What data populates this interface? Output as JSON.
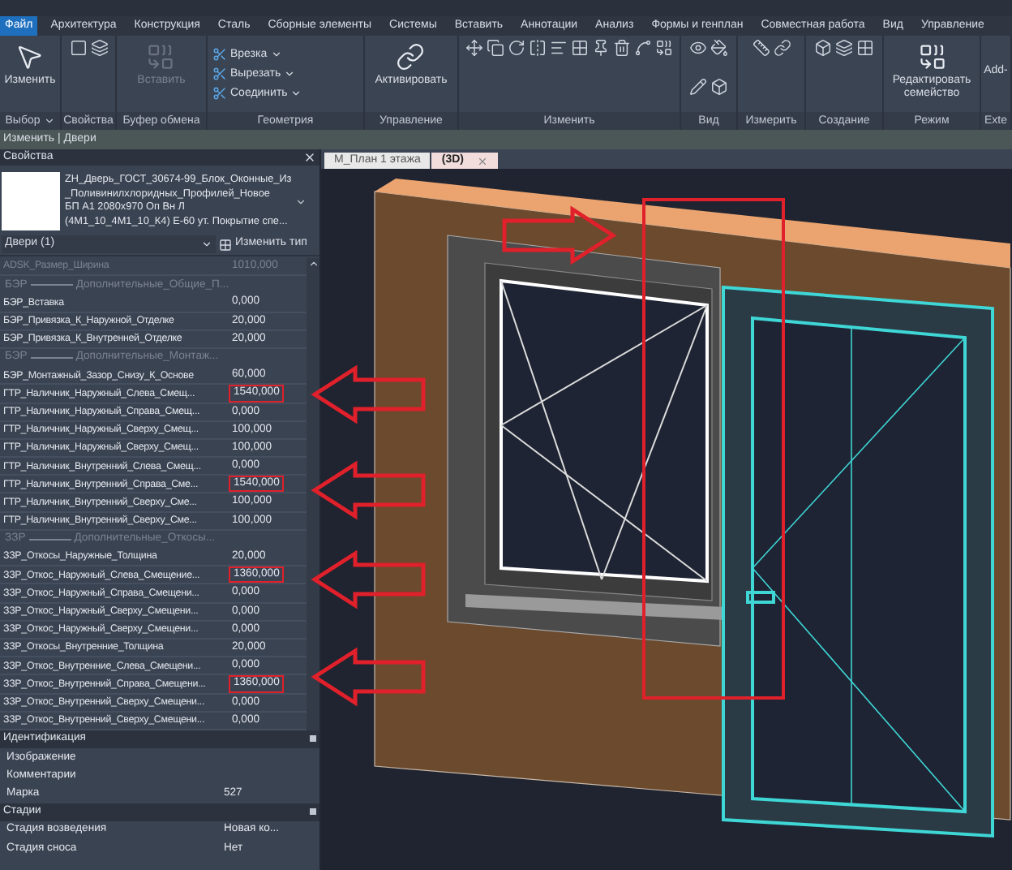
{
  "menu": [
    {
      "label": "Файл",
      "selected": true
    },
    {
      "label": "Архитектура",
      "selected": false
    },
    {
      "label": "Конструкция",
      "selected": false
    },
    {
      "label": "Сталь",
      "selected": false
    },
    {
      "label": "Сборные элементы",
      "selected": false
    },
    {
      "label": "Системы",
      "selected": false
    },
    {
      "label": "Вставить",
      "selected": false
    },
    {
      "label": "Аннотации",
      "selected": false
    },
    {
      "label": "Анализ",
      "selected": false
    },
    {
      "label": "Формы и генплан",
      "selected": false
    },
    {
      "label": "Совместная работа",
      "selected": false
    },
    {
      "label": "Вид",
      "selected": false
    },
    {
      "label": "Управление",
      "selected": false
    }
  ],
  "ribbon": [
    {
      "label": "Выбор",
      "dropdown": true,
      "tools": [
        {
          "kind": "large",
          "label": "Изменить",
          "disabled": false
        }
      ]
    },
    {
      "label": "Свойства"
    },
    {
      "label": "Буфер обмена",
      "tools": [
        {
          "kind": "large",
          "label": "Вставить",
          "disabled": true
        }
      ]
    },
    {
      "label": "Геометрия",
      "tools": [
        {
          "kind": "stack",
          "label": "Врезка",
          "disabled": false
        },
        {
          "kind": "stack",
          "label": "Вырезать",
          "disabled": false
        },
        {
          "kind": "stack",
          "label": "Соединить",
          "disabled": false
        }
      ]
    },
    {
      "label": "Управление",
      "tools": [
        {
          "kind": "large",
          "label": "Активировать",
          "disabled": false
        }
      ]
    },
    {
      "label": "Изменить"
    },
    {
      "label": "Вид"
    },
    {
      "label": "Измерить"
    },
    {
      "label": "Создание"
    },
    {
      "label": "Режим",
      "tools": [
        {
          "kind": "large",
          "label": "Редактировать семейство",
          "disabled": false
        }
      ]
    },
    {
      "label": "Exte",
      "tools": [
        {
          "kind": "text",
          "label": "Add-",
          "disabled": false
        }
      ]
    }
  ],
  "context_bar": "Изменить | Двери",
  "properties": {
    "title": "Свойства",
    "type_name": [
      "ZH_Дверь_ГОСТ_30674-99_Блок_Оконные_Из",
      "_Поливинилхлоридных_Профилей_Новое",
      "БП А1 2080х970 Оп Вн Л",
      "(4М1_10_4М1_10_К4) Е-60 ут.  Покрытие спе..."
    ],
    "selector": "Двери (1)",
    "edit_type": "Изменить тип",
    "rows": [
      {
        "kind": "param",
        "name": "ADSK_Размер_Ширина",
        "value": "1010,000",
        "disabled": true,
        "highlighted": false
      },
      {
        "kind": "separator",
        "prefix": "БЭР",
        "name": "Дополнительные_Общие_П..."
      },
      {
        "kind": "param",
        "name": "БЭР_Вставка",
        "value": "0,000",
        "disabled": false,
        "highlighted": false
      },
      {
        "kind": "param",
        "name": "БЭР_Привязка_К_Наружной_Отделке",
        "value": "20,000",
        "disabled": false,
        "highlighted": false
      },
      {
        "kind": "param",
        "name": "БЭР_Привязка_К_Внутренней_Отделке",
        "value": "20,000",
        "disabled": false,
        "highlighted": false
      },
      {
        "kind": "separator",
        "prefix": "БЭР",
        "name": "Дополнительные_Монтаж..."
      },
      {
        "kind": "param",
        "name": "БЭР_Монтажный_Зазор_Снизу_К_Основе",
        "value": "60,000",
        "disabled": false,
        "highlighted": false
      },
      {
        "kind": "param",
        "name": "ГТР_Наличник_Наружный_Слева_Смещ...",
        "value": "1540,000",
        "disabled": false,
        "highlighted": true
      },
      {
        "kind": "param",
        "name": "ГТР_Наличник_Наружный_Справа_Смещ...",
        "value": "0,000",
        "disabled": false,
        "highlighted": false
      },
      {
        "kind": "param",
        "name": "ГТР_Наличник_Наружный_Сверху_Смещ...",
        "value": "100,000",
        "disabled": false,
        "highlighted": false
      },
      {
        "kind": "param",
        "name": "ГТР_Наличник_Наружный_Сверху_Смещ...",
        "value": "100,000",
        "disabled": false,
        "highlighted": false
      },
      {
        "kind": "param",
        "name": "ГТР_Наличник_Внутренний_Слева_Смещ...",
        "value": "0,000",
        "disabled": false,
        "highlighted": false
      },
      {
        "kind": "param",
        "name": "ГТР_Наличник_Внутренний_Справа_Сме...",
        "value": "1540,000",
        "disabled": false,
        "highlighted": true
      },
      {
        "kind": "param",
        "name": "ГТР_Наличник_Внутренний_Сверху_Сме...",
        "value": "100,000",
        "disabled": false,
        "highlighted": false
      },
      {
        "kind": "param",
        "name": "ГТР_Наличник_Внутренний_Сверху_Сме...",
        "value": "100,000",
        "disabled": false,
        "highlighted": false
      },
      {
        "kind": "separator",
        "prefix": "ЗЗР",
        "name": "Дополнительные_Откосы..."
      },
      {
        "kind": "param",
        "name": "ЗЗР_Откосы_Наружные_Толщина",
        "value": "20,000",
        "disabled": false,
        "highlighted": false
      },
      {
        "kind": "param",
        "name": "ЗЗР_Откос_Наружный_Слева_Смещение...",
        "value": "1360,000",
        "disabled": false,
        "highlighted": true
      },
      {
        "kind": "param",
        "name": "ЗЗР_Откос_Наружный_Справа_Смещени...",
        "value": "0,000",
        "disabled": false,
        "highlighted": false
      },
      {
        "kind": "param",
        "name": "ЗЗР_Откос_Наружный_Сверху_Смещени...",
        "value": "0,000",
        "disabled": false,
        "highlighted": false
      },
      {
        "kind": "param",
        "name": "ЗЗР_Откос_Наружный_Сверху_Смещени...",
        "value": "0,000",
        "disabled": false,
        "highlighted": false
      },
      {
        "kind": "param",
        "name": "ЗЗР_Откосы_Внутренние_Толщина",
        "value": "20,000",
        "disabled": false,
        "highlighted": false
      },
      {
        "kind": "param",
        "name": "ЗЗР_Откос_Внутренние_Слева_Смещени...",
        "value": "0,000",
        "disabled": false,
        "highlighted": false
      },
      {
        "kind": "param",
        "name": "ЗЗР_Откос_Внутренний_Справа_Смещени...",
        "value": "1360,000",
        "disabled": false,
        "highlighted": true
      },
      {
        "kind": "param",
        "name": "ЗЗР_Откос_Внутренний_Сверху_Смещени...",
        "value": "0,000",
        "disabled": false,
        "highlighted": false
      },
      {
        "kind": "param",
        "name": "ЗЗР_Откос_Внутренний_Сверху_Смещени...",
        "value": "0,000",
        "disabled": false,
        "highlighted": false
      }
    ],
    "groups": [
      {
        "title": "Идентификация",
        "rows": [
          {
            "name": "Изображение"
          },
          {
            "name": "Комментарии"
          },
          {
            "name": "Марка",
            "value": "527"
          }
        ]
      },
      {
        "title": "Стадии",
        "rows": [
          {
            "name": "Стадия возведения",
            "value": "Новая ко..."
          },
          {
            "name": "Стадия сноса",
            "value": "Нет"
          }
        ]
      }
    ]
  },
  "view_tabs": [
    {
      "label": "М_План 1 этажа",
      "selected": false,
      "closable": false
    },
    {
      "label": "(3D)",
      "selected": true,
      "closable": true
    }
  ]
}
